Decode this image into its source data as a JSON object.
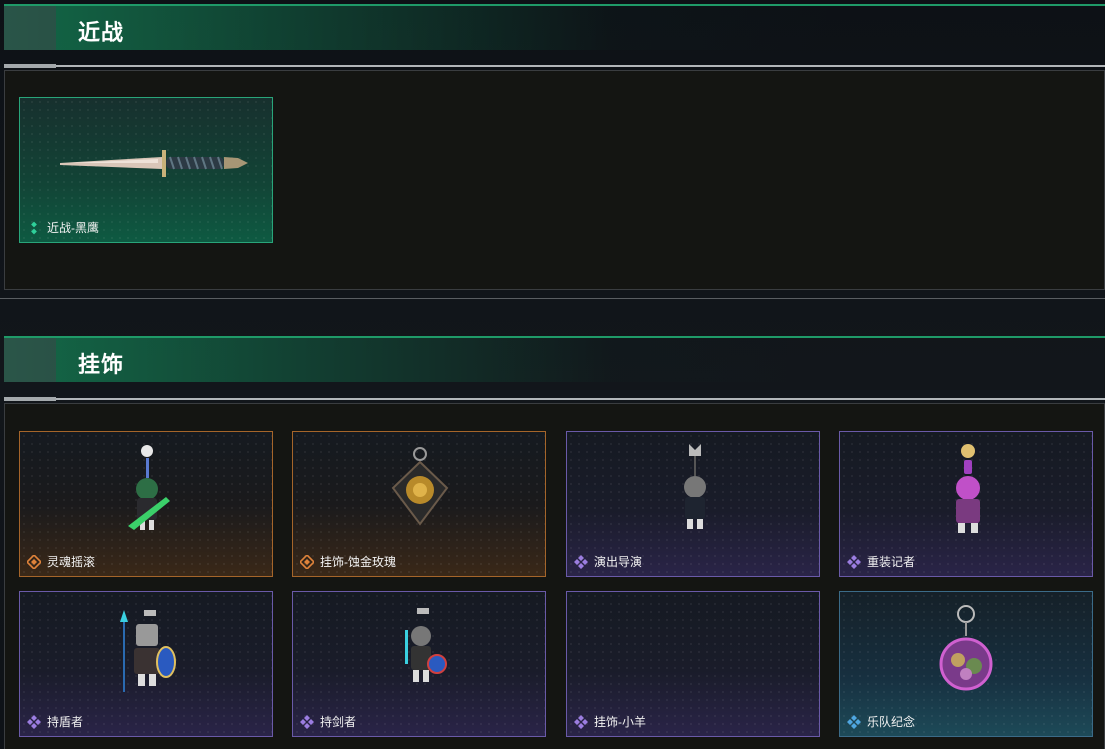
{
  "sections": [
    {
      "title": "近战",
      "items": [
        {
          "name": "近战-黑鹰",
          "rarity": "green",
          "icon": "knife-icon"
        }
      ]
    },
    {
      "title": "挂饰",
      "items": [
        {
          "name": "灵魂摇滚",
          "rarity": "orange",
          "icon": "guitarist-charm-icon"
        },
        {
          "name": "挂饰-蚀金玫瑰",
          "rarity": "orange",
          "icon": "rose-charm-icon"
        },
        {
          "name": "演出导演",
          "rarity": "purple",
          "icon": "wolf-helmet-charm-icon"
        },
        {
          "name": "重装记者",
          "rarity": "purple",
          "icon": "reporter-charm-icon"
        },
        {
          "name": "持盾者",
          "rarity": "purple",
          "icon": "shield-knight-charm-icon"
        },
        {
          "name": "持剑者",
          "rarity": "purple",
          "icon": "swordsman-charm-icon"
        },
        {
          "name": "挂饰-小羊",
          "rarity": "purple",
          "icon": "lamb-charm-icon"
        },
        {
          "name": "乐队纪念",
          "rarity": "blue",
          "icon": "band-badge-charm-icon"
        }
      ]
    }
  ],
  "colors": {
    "accent_green": "#1f9a68",
    "rarity_orange": "#e0833a",
    "rarity_purple": "#9b7de0",
    "rarity_blue": "#4fa6e0",
    "rarity_green": "#2fd09a"
  }
}
